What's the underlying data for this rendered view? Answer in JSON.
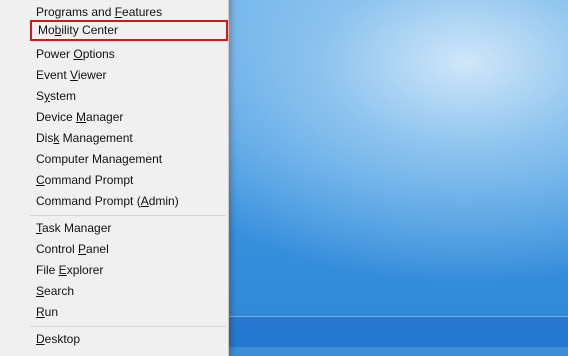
{
  "menu": {
    "items": [
      {
        "pre": "Programs and ",
        "acc": "F",
        "post": "eatures"
      },
      {
        "pre": "Mo",
        "acc": "b",
        "post": "ility Center",
        "highlight": true
      },
      {
        "pre": "Power ",
        "acc": "O",
        "post": "ptions"
      },
      {
        "pre": "Event ",
        "acc": "V",
        "post": "iewer"
      },
      {
        "pre": "S",
        "acc": "y",
        "post": "stem"
      },
      {
        "pre": "Device ",
        "acc": "M",
        "post": "anager"
      },
      {
        "pre": "Dis",
        "acc": "k",
        "post": " Management"
      },
      {
        "pre": "Computer Mana",
        "acc": "g",
        "post": "ement"
      },
      {
        "pre": "",
        "acc": "C",
        "post": "ommand Prompt"
      },
      {
        "pre": "Command Prompt (",
        "acc": "A",
        "post": "dmin)"
      },
      {
        "pre": "",
        "acc": "T",
        "post": "ask Manager"
      },
      {
        "pre": "Control ",
        "acc": "P",
        "post": "anel"
      },
      {
        "pre": "File ",
        "acc": "E",
        "post": "xplorer"
      },
      {
        "pre": "",
        "acc": "S",
        "post": "earch"
      },
      {
        "pre": "",
        "acc": "R",
        "post": "un"
      },
      {
        "pre": "",
        "acc": "D",
        "post": "esktop"
      }
    ]
  }
}
